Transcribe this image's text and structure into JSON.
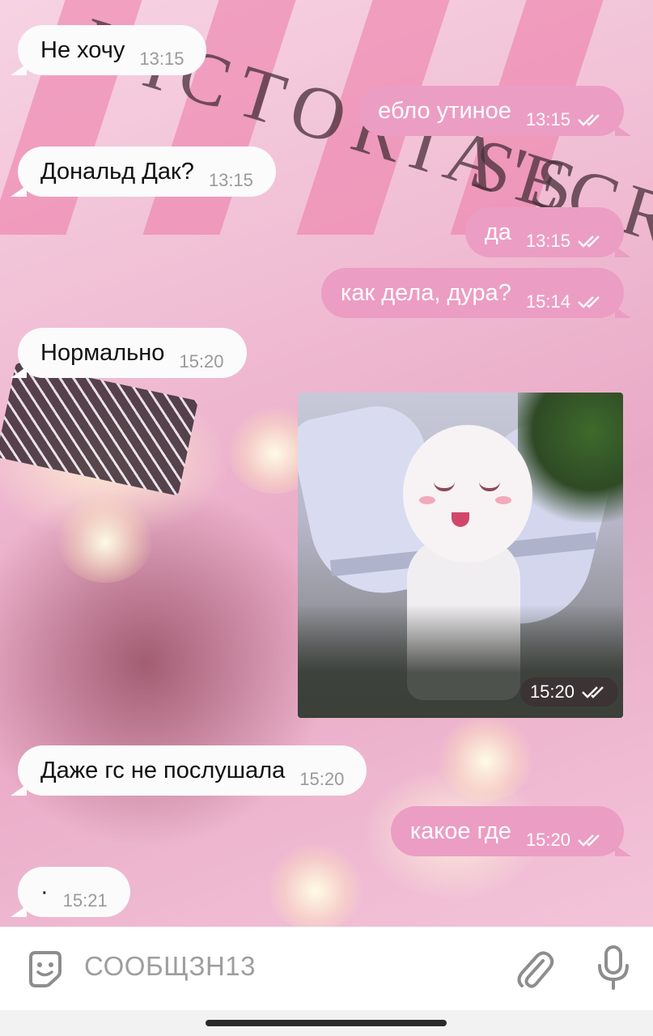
{
  "wallpaper": {
    "text_top": "VICTORIA'S",
    "text_side": "SECR"
  },
  "messages": [
    {
      "dir": "in",
      "text": "Не хочу",
      "time": "13:15"
    },
    {
      "dir": "out",
      "text": "ебло утиное",
      "time": "13:15",
      "status": "read"
    },
    {
      "dir": "in",
      "text": "Дональд Дак?",
      "time": "13:15"
    },
    {
      "dir": "out",
      "text": "да",
      "time": "13:15",
      "status": "read"
    },
    {
      "dir": "out",
      "text": "как дела, дура?",
      "time": "15:14",
      "status": "read"
    },
    {
      "dir": "in",
      "text": "Нормально",
      "time": "15:20"
    },
    {
      "dir": "out",
      "type": "image",
      "time": "15:20",
      "status": "read"
    },
    {
      "dir": "in",
      "text": "Даже гс не послушала",
      "time": "15:20"
    },
    {
      "dir": "out",
      "text": "какое где",
      "time": "15:20",
      "status": "read"
    },
    {
      "dir": "in",
      "text": "·",
      "time": "15:21"
    }
  ],
  "input": {
    "placeholder": "СООБЩЗН13"
  },
  "icons": {
    "emoji": "sticker-emoji-icon",
    "attach": "paperclip-icon",
    "mic": "microphone-icon",
    "read": "double-check-icon"
  },
  "colors": {
    "outgoing_bubble": "#ec9dc4",
    "incoming_bubble": "#fbfbfb"
  }
}
